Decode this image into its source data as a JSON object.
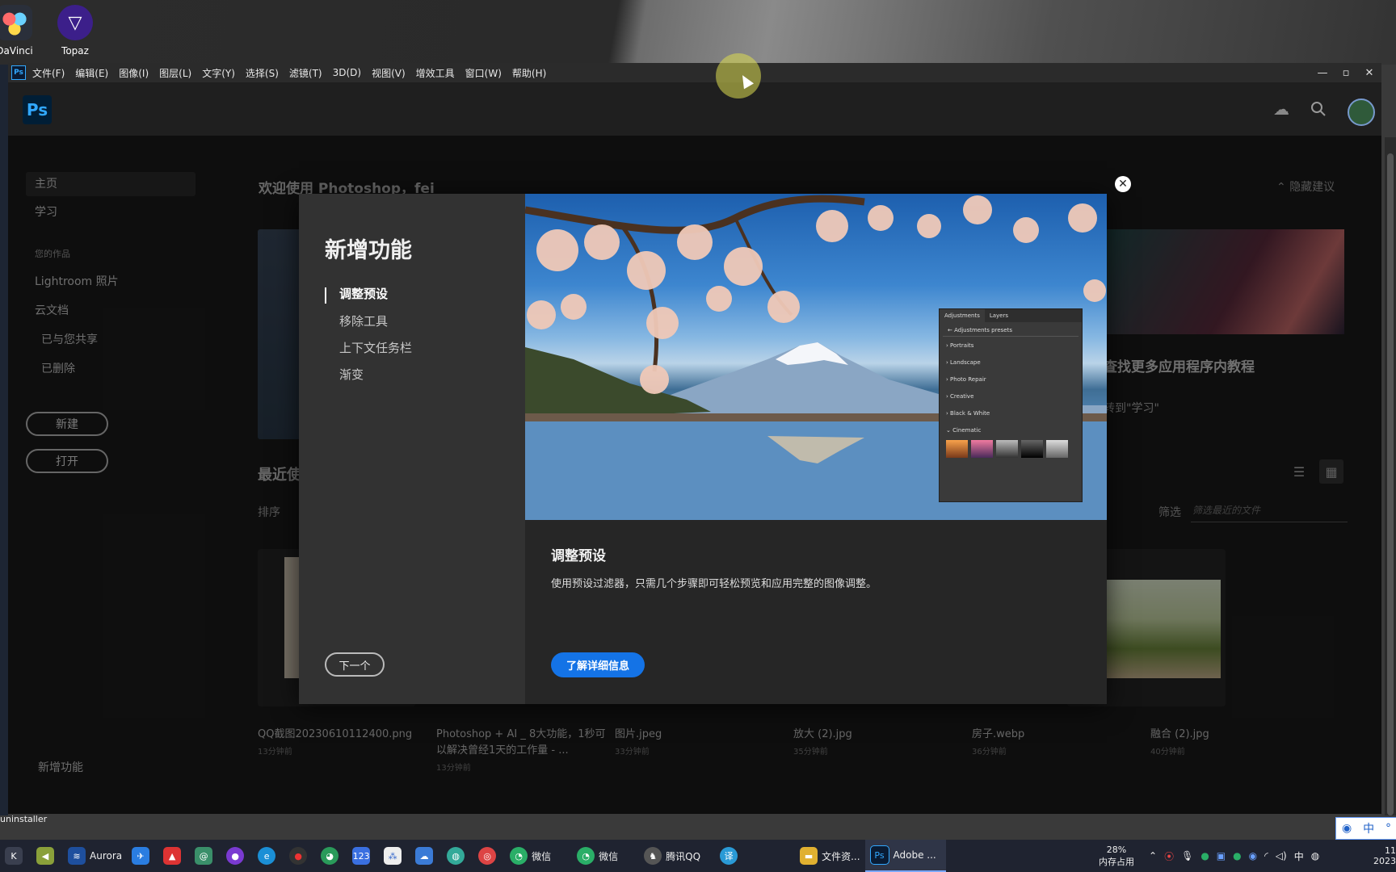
{
  "desktop": {
    "icons": [
      {
        "label": "DaVinci",
        "icon": "davinci-icon"
      },
      {
        "label": "Topaz",
        "icon": "topaz-icon"
      }
    ],
    "installer_label": "uninstaller"
  },
  "menubar": {
    "app_badge": "Ps",
    "items": [
      "文件(F)",
      "编辑(E)",
      "图像(I)",
      "图层(L)",
      "文字(Y)",
      "选择(S)",
      "滤镜(T)",
      "3D(D)",
      "视图(V)",
      "增效工具",
      "窗口(W)",
      "帮助(H)"
    ],
    "controls": [
      "minimize",
      "maximize",
      "close"
    ]
  },
  "header": {
    "logo": "Ps",
    "icons": [
      "cloud-icon",
      "search-icon",
      "avatar"
    ]
  },
  "sidebar": {
    "items": [
      {
        "label": "主页",
        "active": true
      },
      {
        "label": "学习"
      }
    ],
    "section_label": "您的作品",
    "work_items": [
      "Lightroom 照片",
      "云文档",
      "已与您共享",
      "已删除"
    ],
    "new_button": "新建",
    "open_button": "打开",
    "whats_new": "新增功能"
  },
  "home": {
    "welcome": "欢迎使用 Photoshop，fei",
    "hide_suggestions": "隐藏建议",
    "promo_title": "查找更多应用程序内教程",
    "promo_sub": "转到\"学习\"",
    "recent_title": "最近使",
    "sort_label": "排序",
    "filter_label": "筛选",
    "filter_placeholder": "筛选最近的文件",
    "files": [
      {
        "name": "QQ截图20230610112400.png",
        "time": "13分钟前"
      },
      {
        "name": "Photoshop + AI _ 8大功能，1秒可以解决曾经1天的工作量 - ...",
        "time": "13分钟前"
      },
      {
        "name": "图片.jpeg",
        "time": "33分钟前"
      },
      {
        "name": "放大 (2).jpg",
        "time": "35分钟前"
      },
      {
        "name": "房子.webp",
        "time": "36分钟前"
      },
      {
        "name": "融合 (2).jpg",
        "time": "40分钟前"
      }
    ]
  },
  "modal": {
    "title": "新增功能",
    "features": [
      {
        "label": "调整预设",
        "active": true
      },
      {
        "label": "移除工具"
      },
      {
        "label": "上下文任务栏"
      },
      {
        "label": "渐变"
      }
    ],
    "next_button": "下一个",
    "desc_title": "调整预设",
    "desc": "使用预设过滤器，只需几个步骤即可轻松预览和应用完整的图像调整。",
    "learn_more": "了解详细信息",
    "close_icon": "close-icon",
    "panel": {
      "tabs": [
        "Adjustments",
        "Layers"
      ],
      "back_label": "Adjustments presets",
      "rows": [
        "Portraits",
        "Landscape",
        "Photo Repair",
        "Creative",
        "Black & White",
        "Cinematic"
      ]
    }
  },
  "taskbar": {
    "apps": [
      {
        "label": "",
        "icon": "k-icon",
        "color": "#3a3f4f"
      },
      {
        "label": "",
        "icon": "arrow-app-icon",
        "color": "#8aa03a"
      },
      {
        "label": "Aurora",
        "icon": "aurora-icon",
        "color": "#1e4f9e"
      },
      {
        "label": "",
        "icon": "bird-icon",
        "color": "#2a7de1"
      },
      {
        "label": "",
        "icon": "chart-app-icon",
        "color": "#d33"
      },
      {
        "label": "",
        "icon": "at-app-icon",
        "color": "#3a8f6a"
      },
      {
        "label": "",
        "icon": "purple-app-icon",
        "color": "#7a3ad1"
      },
      {
        "label": "",
        "icon": "edge-icon",
        "color": "#1b8fd6"
      },
      {
        "label": "",
        "icon": "record-icon",
        "color": "#333"
      },
      {
        "label": "",
        "icon": "panda-icon",
        "color": "#2a9a5a"
      },
      {
        "label": "",
        "icon": "123-icon",
        "color": "#3a6fe0"
      },
      {
        "label": "",
        "icon": "nodes-icon",
        "color": "#eee"
      },
      {
        "label": "",
        "icon": "onedrive-icon",
        "color": "#3b7bd6"
      },
      {
        "label": "",
        "icon": "globe-app-icon",
        "color": "#3a9"
      },
      {
        "label": "",
        "icon": "chrome-icon",
        "color": "#d44"
      },
      {
        "label": "微信",
        "icon": "wechat-icon",
        "color": "#2aae67"
      },
      {
        "label": "微信",
        "icon": "wechat-icon",
        "color": "#2aae67"
      },
      {
        "label": "腾讯QQ",
        "icon": "qq-icon",
        "color": "#555"
      },
      {
        "label": "",
        "icon": "translate-icon",
        "color": "#2a9ad6"
      },
      {
        "label": "文件资...",
        "icon": "folder-icon",
        "color": "#e0b030"
      },
      {
        "label": "Adobe ...",
        "icon": "photoshop-icon",
        "color": "#0a1b33",
        "active": true
      }
    ],
    "memory_percent": "28%",
    "memory_label": "内存占用",
    "ime": "中",
    "clock_time": "11",
    "clock_date": "2023"
  },
  "colors": {
    "accent": "#1473e6",
    "ps_blue": "#31a8ff"
  }
}
